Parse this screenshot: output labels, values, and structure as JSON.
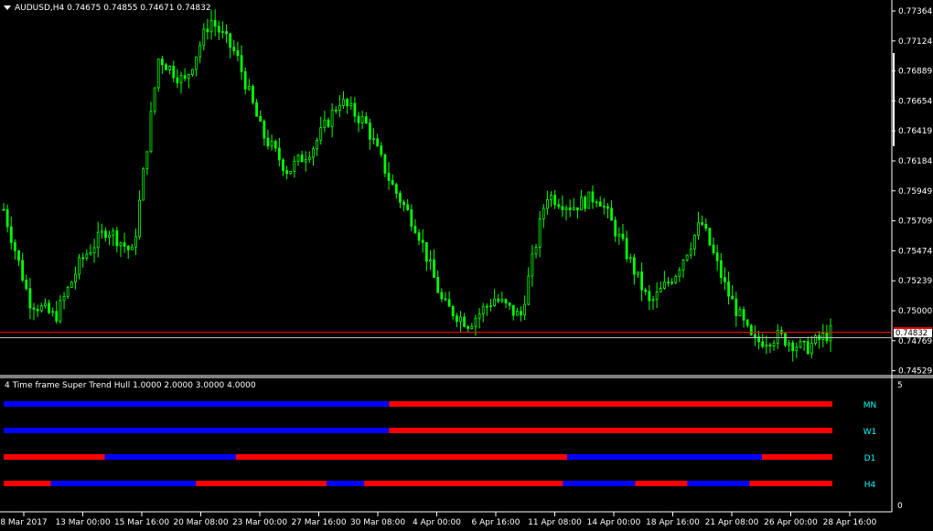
{
  "window": {
    "symbol_line": "AUDUSD,H4  0.74675 0.74855 0.74671 0.74832"
  },
  "price_axis": {
    "labels": [
      "0.77364",
      "0.77124",
      "0.76889",
      "0.76654",
      "0.76419",
      "0.76184",
      "0.75949",
      "0.75709",
      "0.75474",
      "0.75239",
      "0.75000",
      "0.74769",
      "0.74529"
    ],
    "current_price": "0.74832",
    "current_price_color": "#ff0000",
    "ask_line_color": "#c0c0c0"
  },
  "time_axis": {
    "labels": [
      "8 Mar 2017",
      "13 Mar 00:00",
      "15 Mar 16:00",
      "20 Mar 08:00",
      "23 Mar 00:00",
      "27 Mar 16:00",
      "30 Mar 08:00",
      "4 Apr 00:00",
      "6 Apr 16:00",
      "11 Apr 08:00",
      "14 Apr 00:00",
      "18 Apr 16:00",
      "21 Apr 08:00",
      "26 Apr 00:00",
      "28 Apr 16:00"
    ]
  },
  "indicator": {
    "title": "4 Time frame Super Trend Hull 1.0000 2.0000 3.0000 4.0000",
    "scale_max": "5",
    "scale_min": "0",
    "colors": {
      "up": "#0000ff",
      "down": "#ff0000",
      "label": "#00ffff"
    },
    "rows": [
      {
        "label": "MN",
        "segments": [
          [
            "up",
            0.0,
            0.465
          ],
          [
            "down",
            0.465,
            1.0
          ]
        ]
      },
      {
        "label": "W1",
        "segments": [
          [
            "up",
            0.0,
            0.465
          ],
          [
            "down",
            0.465,
            1.0
          ]
        ]
      },
      {
        "label": "D1",
        "segments": [
          [
            "down",
            0.0,
            0.122
          ],
          [
            "up",
            0.122,
            0.28
          ],
          [
            "down",
            0.28,
            0.68
          ],
          [
            "up",
            0.68,
            0.915
          ],
          [
            "down",
            0.915,
            1.0
          ]
        ]
      },
      {
        "label": "H4",
        "segments": [
          [
            "down",
            0.0,
            0.057
          ],
          [
            "up",
            0.057,
            0.232
          ],
          [
            "down",
            0.232,
            0.39
          ],
          [
            "up",
            0.39,
            0.435
          ],
          [
            "down",
            0.435,
            0.675
          ],
          [
            "up",
            0.675,
            0.762
          ],
          [
            "down",
            0.762,
            0.825
          ],
          [
            "up",
            0.825,
            0.9
          ],
          [
            "down",
            0.9,
            1.0
          ]
        ]
      }
    ]
  },
  "chart_data": {
    "type": "line",
    "title": "AUDUSD,H4",
    "candle_color": "#00ff00",
    "ylim": [
      0.7445,
      0.7745
    ],
    "x": [
      "8 Mar 2017",
      "13 Mar 00:00",
      "15 Mar 16:00",
      "20 Mar 08:00",
      "23 Mar 00:00",
      "27 Mar 16:00",
      "30 Mar 08:00",
      "4 Apr 00:00",
      "6 Apr 16:00",
      "11 Apr 08:00",
      "14 Apr 00:00",
      "18 Apr 16:00",
      "21 Apr 08:00",
      "26 Apr 00:00",
      "28 Apr 16:00"
    ],
    "series": [
      {
        "values": [
          0.758,
          0.7508,
          0.7495,
          0.754,
          0.7565,
          0.7545,
          0.77,
          0.768,
          0.773,
          0.7702,
          0.764,
          0.761,
          0.763,
          0.7666,
          0.7648,
          0.76,
          0.7565,
          0.7505,
          0.749,
          0.751,
          0.7495,
          0.7592,
          0.7582,
          0.7591,
          0.755,
          0.7505,
          0.753,
          0.757,
          0.7515,
          0.7475,
          0.748,
          0.747,
          0.74832
        ]
      }
    ]
  }
}
